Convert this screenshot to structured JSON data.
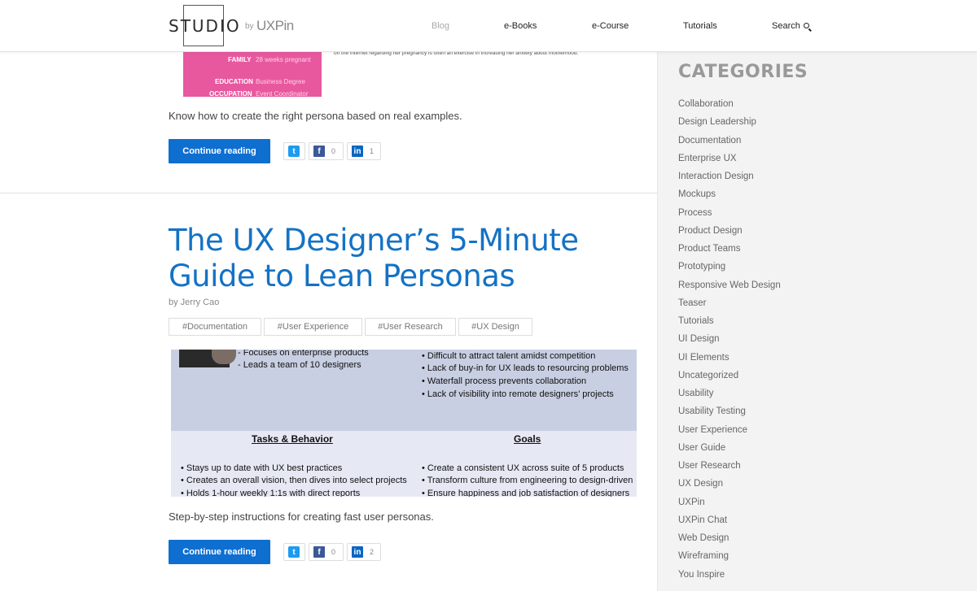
{
  "header": {
    "logo_text": "STUDIO",
    "logo_by": "by",
    "logo_brand": "UXPin",
    "nav": [
      "Blog",
      "e-Books",
      "e-Course",
      "Tutorials",
      "Search"
    ]
  },
  "post1": {
    "image_rows": [
      {
        "label": "FAMILY",
        "value": "28 weeks pregnant"
      },
      {
        "label": "EDUCATION",
        "value": "Business Degree"
      },
      {
        "label": "OCCUPATION",
        "value": "Event Coordinator"
      }
    ],
    "image_side_text": "on the internet regarding her pregnancy is often an exercise in increasing her anxiety about motherhood.",
    "excerpt": "Know how to create the right persona based on real examples.",
    "button": "Continue reading",
    "facebook_count": "0",
    "linkedin_count": "1"
  },
  "post2": {
    "title": "The UX Designer’s 5-Minute Guide to Lean Personas",
    "byline": "by Jerry Cao",
    "tags": [
      "#Documentation",
      "#User Experience",
      "#User Research",
      "#UX Design"
    ],
    "persona": {
      "left_top": [
        "- Focuses on enterprise products",
        "- Leads a team of 10 designers"
      ],
      "right_top": [
        "• Difficult to attract talent amidst competition",
        "• Lack of buy-in for UX leads to resourcing problems",
        "• Waterfall process prevents collaboration",
        "• Lack of visibility into remote designers’ projects"
      ],
      "tasks_heading": "Tasks & Behavior",
      "goals_heading": "Goals",
      "tasks": [
        "• Stays up to date with UX best practices",
        "• Creates an overall vision, then dives into select projects",
        "• Holds 1-hour weekly 1:1s with direct reports"
      ],
      "goals": [
        "• Create a consistent UX across suite of 5 products",
        "• Transform culture from engineering to design-driven",
        "• Ensure happiness and job satisfaction of designers"
      ]
    },
    "excerpt": "Step-by-step instructions for creating fast user personas.",
    "button": "Continue reading",
    "facebook_count": "0",
    "linkedin_count": "2"
  },
  "sidebar": {
    "title": "CATEGORIES",
    "items": [
      "Collaboration",
      "Design Leadership",
      "Documentation",
      "Enterprise UX",
      "Interaction Design",
      "Mockups",
      "Process",
      "Product Design",
      "Product Teams",
      "Prototyping",
      "Responsive Web Design",
      "Teaser",
      "Tutorials",
      "UI Design",
      "UI Elements",
      "Uncategorized",
      "Usability",
      "Usability Testing",
      "User Experience",
      "User Guide",
      "User Research",
      "UX Design",
      "UXPin",
      "UXPin Chat",
      "Web Design",
      "Wireframing",
      "You Inspire"
    ]
  }
}
